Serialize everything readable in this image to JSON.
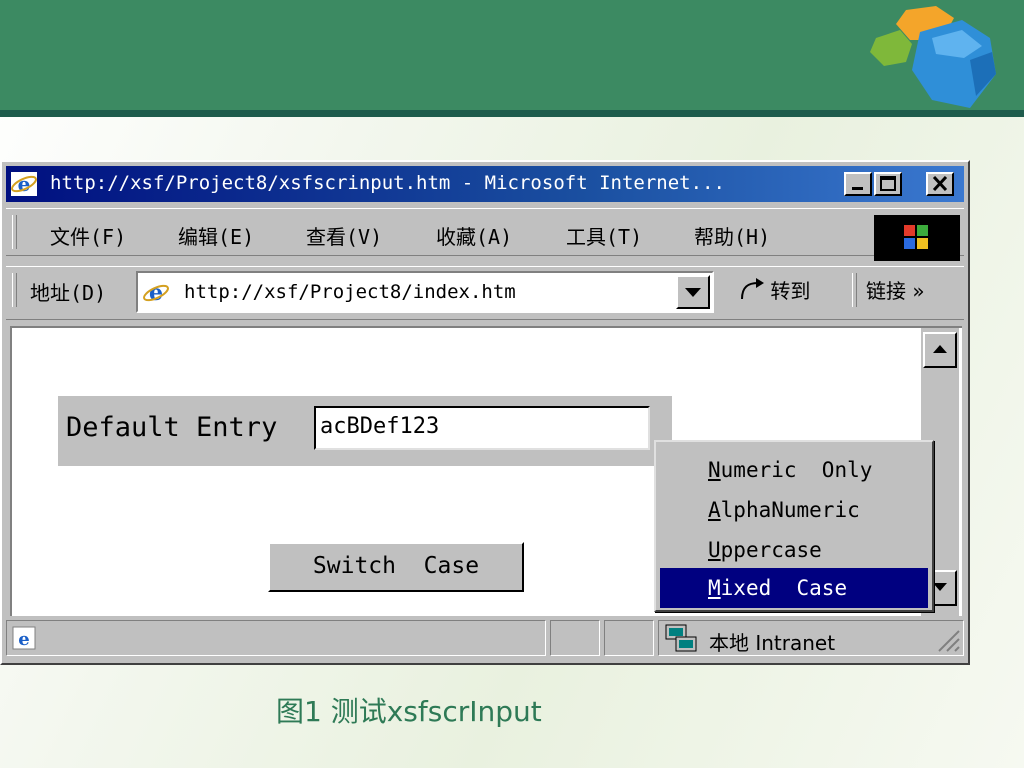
{
  "colors": {
    "header": "#3c8a62",
    "header_rule": "#1e5c4c",
    "titlebar": "#000f80",
    "selection": "#000080",
    "caption": "#2e7a56"
  },
  "window": {
    "title": "http://xsf/Project8/xsfscrinput.htm - Microsoft Internet...",
    "icon": "ie-icon",
    "controls": [
      "minimize-icon",
      "maximize-icon",
      "close-icon"
    ]
  },
  "menubar": {
    "items": [
      {
        "label": "文件(F)"
      },
      {
        "label": "编辑(E)"
      },
      {
        "label": "查看(V)"
      },
      {
        "label": "收藏(A)"
      },
      {
        "label": "工具(T)"
      },
      {
        "label": "帮助(H)"
      }
    ],
    "throbber": "windows-logo-icon"
  },
  "addressbar": {
    "label": "地址(D)",
    "url": "http://xsf/Project8/index.htm",
    "go_label": "转到",
    "links_label": "链接 »"
  },
  "page": {
    "entry_label": "Default Entry",
    "entry_value": "acBDef123",
    "switch_button": "Switch  Case"
  },
  "context_menu": {
    "items": [
      {
        "label": "Numeric  Only",
        "underline": "N",
        "selected": false
      },
      {
        "label": "AlphaNumeric",
        "underline": "A",
        "selected": false
      },
      {
        "label": "Uppercase",
        "underline": "U",
        "selected": false
      },
      {
        "label": "Mixed  Case",
        "underline": "M",
        "selected": true
      }
    ]
  },
  "statusbar": {
    "zone": "本地 Intranet"
  },
  "caption": "图1  测试xsfscrInput"
}
